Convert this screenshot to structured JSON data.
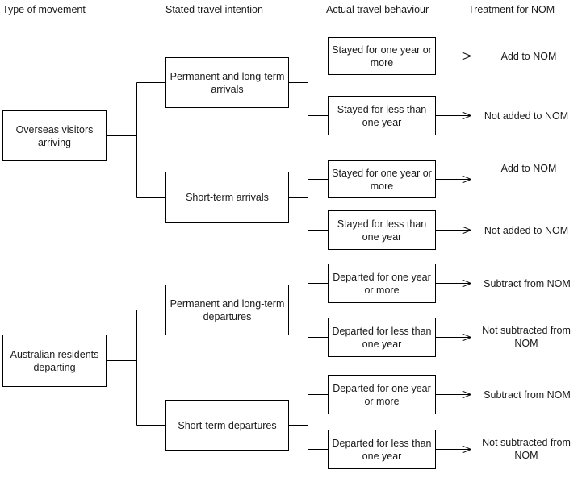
{
  "diagram": {
    "title": "Net Overseas Migration (NOM) traveller classification flowchart",
    "line_color": "#000000",
    "text_color": "#1a1a1a",
    "background": "#ffffff"
  },
  "headers": [
    {
      "label": "Type of movement"
    },
    {
      "label": "Stated travel intention"
    },
    {
      "label": "Actual travel behaviour"
    },
    {
      "label": "Treatment for NOM"
    }
  ],
  "sources": [
    {
      "label": "Overseas visitors arriving"
    },
    {
      "label": "Australian residents departing"
    }
  ],
  "intentions": [
    {
      "label": "Permanent and long-term arrivals"
    },
    {
      "label": "Short-term arrivals"
    },
    {
      "label": "Permanent and long-term departures"
    },
    {
      "label": "Short-term departures"
    }
  ],
  "behaviours": [
    {
      "label": "Stayed for one year or more"
    },
    {
      "label": "Stayed for less than one year"
    },
    {
      "label": "Stayed for one year or more"
    },
    {
      "label": "Stayed for less than one year"
    },
    {
      "label": "Departed for one year or more"
    },
    {
      "label": "Departed for less than one year"
    },
    {
      "label": "Departed for one year or more"
    },
    {
      "label": "Departed for less than one year"
    }
  ],
  "treatments": [
    {
      "label": "Add to NOM"
    },
    {
      "label": "Not added to NOM"
    },
    {
      "label": "Add to NOM"
    },
    {
      "label": "Not added to NOM"
    },
    {
      "label": "Subtract from NOM"
    },
    {
      "label": "Not subtracted from NOM"
    },
    {
      "label": "Subtract from NOM"
    },
    {
      "label": "Not subtracted from NOM"
    }
  ],
  "icons": {
    "arrow": "arrow-right-icon"
  }
}
